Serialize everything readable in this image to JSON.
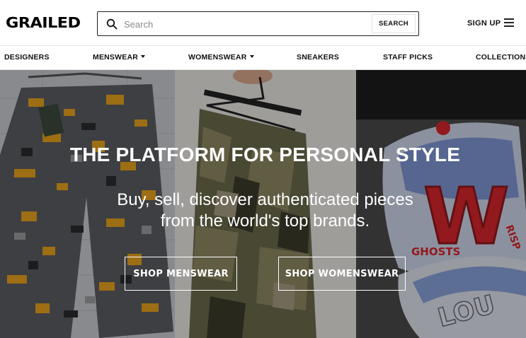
{
  "header": {
    "logo": "GRAILED",
    "search": {
      "placeholder": "Search",
      "value": "",
      "button_label": "SEARCH",
      "icon": "search-icon"
    },
    "signup_label": "SIGN UP",
    "menu_icon": "hamburger-menu-icon"
  },
  "nav": {
    "items": [
      {
        "label": "DESIGNERS",
        "dropdown": false
      },
      {
        "label": "MENSWEAR",
        "dropdown": true
      },
      {
        "label": "WOMENSWEAR",
        "dropdown": true
      },
      {
        "label": "SNEAKERS",
        "dropdown": false
      },
      {
        "label": "STAFF PICKS",
        "dropdown": false
      },
      {
        "label": "COLLECTIONS",
        "dropdown": false
      }
    ]
  },
  "hero": {
    "title": "THE PLATFORM FOR PERSONAL STYLE",
    "subtitle_line1": "Buy, sell, discover authenticated pieces",
    "subtitle_line2": "from the world's top brands.",
    "buttons": {
      "menswear": "SHOP MENSWEAR",
      "womenswear": "SHOP WOMENSWEAR"
    },
    "cap_text": {
      "letter": "W",
      "word1": "GHOSTS",
      "word2": "RISP",
      "word3": "LOU"
    }
  },
  "colors": {
    "accent_dark": "#111111",
    "camo_yellow": "#e8a21c",
    "camo_gray": "#6d6f73",
    "cap_red": "#d8262b",
    "cap_blue": "#6f8fcf"
  }
}
